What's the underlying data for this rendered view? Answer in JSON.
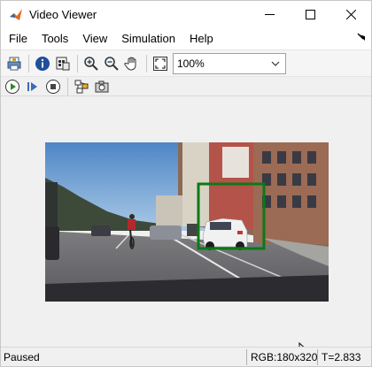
{
  "window": {
    "title": "Video Viewer",
    "icons": {
      "app": "matlab-icon",
      "minimize": "minimize-icon",
      "maximize": "maximize-icon",
      "close": "close-icon"
    }
  },
  "menu": {
    "items": [
      "File",
      "Tools",
      "View",
      "Simulation",
      "Help"
    ],
    "overflow_icon": "chevron-icon"
  },
  "toolbar": {
    "zoom_value": "100%",
    "icons": [
      "print-icon",
      "info-icon",
      "export-icon",
      "zoom-in-icon",
      "zoom-out-icon",
      "pan-icon",
      "fit-window-icon",
      "dropdown-arrow-icon"
    ]
  },
  "playback": {
    "icons": [
      "play-icon",
      "step-forward-icon",
      "stop-icon",
      "highlight-icon",
      "snapshot-icon"
    ]
  },
  "video": {
    "description_icon": "video-frame",
    "box_color": "#0a7a16"
  },
  "status": {
    "state": "Paused",
    "resolution": "RGB:180x320",
    "time": "T=2.833"
  }
}
